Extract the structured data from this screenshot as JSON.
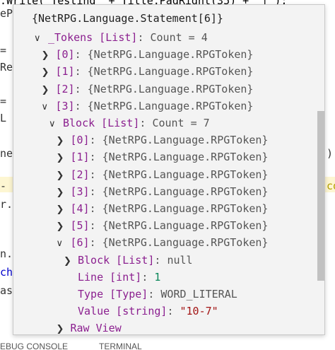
{
  "background": {
    "top_line": ".Write(\"Testing\" + Title.PadRight(35) + \"|\");",
    "left_fragments": [
      "eP",
      "=",
      "Re",
      "=",
      "L",
      "ne",
      "-",
      "r.",
      "n.",
      "ch",
      "as"
    ],
    "right_fragments": [
      ")",
      "co"
    ],
    "bottom_tabs": [
      "EBUG CONSOLE",
      "TERMINAL"
    ]
  },
  "panel": {
    "title": "{NetRPG.Language.Statement[6]}",
    "rows": [
      {
        "indent": 2,
        "chevron": "v",
        "name": "_Tokens [List]",
        "sep": ": ",
        "value": "Count = 4",
        "vtype": "val"
      },
      {
        "indent": 3,
        "chevron": ">",
        "name": "[0]",
        "sep": ": ",
        "value": "{NetRPG.Language.RPGToken}",
        "vtype": "val"
      },
      {
        "indent": 3,
        "chevron": ">",
        "name": "[1]",
        "sep": ": ",
        "value": "{NetRPG.Language.RPGToken}",
        "vtype": "val"
      },
      {
        "indent": 3,
        "chevron": ">",
        "name": "[2]",
        "sep": ": ",
        "value": "{NetRPG.Language.RPGToken}",
        "vtype": "val"
      },
      {
        "indent": 3,
        "chevron": "v",
        "name": "[3]",
        "sep": ": ",
        "value": "{NetRPG.Language.RPGToken}",
        "vtype": "val"
      },
      {
        "indent": 4,
        "chevron": "v",
        "name": "Block [List]",
        "sep": ": ",
        "value": "Count = 7",
        "vtype": "val"
      },
      {
        "indent": 5,
        "chevron": ">",
        "name": "[0]",
        "sep": ": ",
        "value": "{NetRPG.Language.RPGToken}",
        "vtype": "val"
      },
      {
        "indent": 5,
        "chevron": ">",
        "name": "[1]",
        "sep": ": ",
        "value": "{NetRPG.Language.RPGToken}",
        "vtype": "val"
      },
      {
        "indent": 5,
        "chevron": ">",
        "name": "[2]",
        "sep": ": ",
        "value": "{NetRPG.Language.RPGToken}",
        "vtype": "val"
      },
      {
        "indent": 5,
        "chevron": ">",
        "name": "[3]",
        "sep": ": ",
        "value": "{NetRPG.Language.RPGToken}",
        "vtype": "val"
      },
      {
        "indent": 5,
        "chevron": ">",
        "name": "[4]",
        "sep": ": ",
        "value": "{NetRPG.Language.RPGToken}",
        "vtype": "val"
      },
      {
        "indent": 5,
        "chevron": ">",
        "name": "[5]",
        "sep": ": ",
        "value": "{NetRPG.Language.RPGToken}",
        "vtype": "val"
      },
      {
        "indent": 5,
        "chevron": "v",
        "name": "[6]",
        "sep": ": ",
        "value": "{NetRPG.Language.RPGToken}",
        "vtype": "val"
      },
      {
        "indent": 6,
        "chevron": ">",
        "name": "Block [List]",
        "sep": ": ",
        "value": "null",
        "vtype": "val"
      },
      {
        "indent": 6,
        "chevron": "",
        "name": "Line [int]",
        "sep": ": ",
        "value": "1",
        "vtype": "num"
      },
      {
        "indent": 6,
        "chevron": "",
        "name": "Type [Type]",
        "sep": ": ",
        "value": "WORD_LITERAL",
        "vtype": "enum"
      },
      {
        "indent": 6,
        "chevron": "",
        "name": "Value [string]",
        "sep": ": ",
        "value": "\"10-7\"",
        "vtype": "str"
      },
      {
        "indent": 5,
        "chevron": ">",
        "name": "Raw View",
        "sep": "",
        "value": "",
        "vtype": "val"
      }
    ]
  },
  "colors": {
    "name": "#8b1f8f",
    "number": "#098658",
    "string": "#a31515",
    "value": "#555555"
  }
}
